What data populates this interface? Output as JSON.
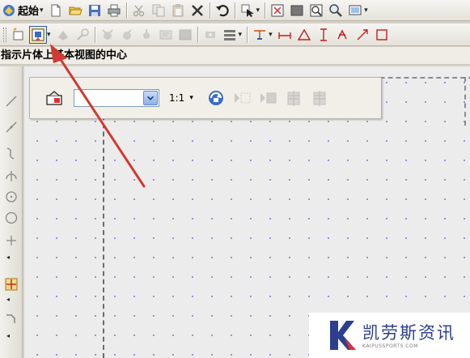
{
  "toolbar": {
    "start_label": "起始",
    "drop_glyph": "▾"
  },
  "status": {
    "prompt_text": "指示片体上基本视图的中心"
  },
  "view_toolbar": {
    "view_select_value": "",
    "scale_value": "1:1",
    "drop_glyph": "▾"
  },
  "watermark": {
    "title": "凯劳斯资讯",
    "subtitle": "KAIPUSSPORTS.COM"
  },
  "colors": {
    "arrow_red": "#d03a32",
    "canvas_bg": "#ececec",
    "grid_dot": "#8a8fd0",
    "watermark_blue": "#2b3f8c"
  }
}
